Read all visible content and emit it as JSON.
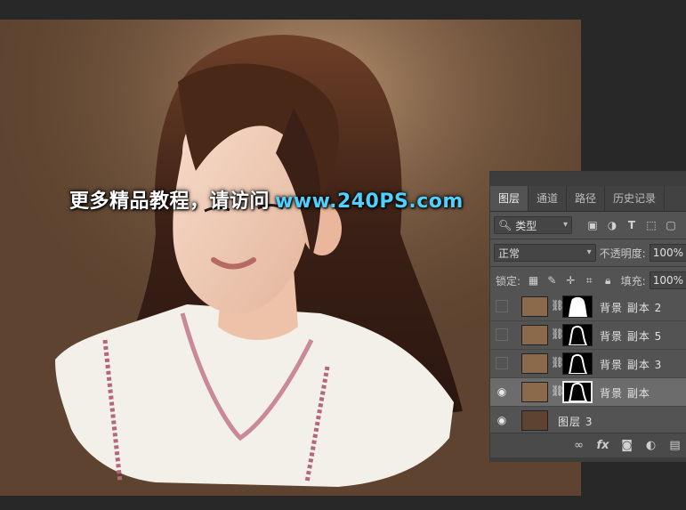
{
  "watermark": {
    "text": "更多精品教程，请访问",
    "url": "www.240PS.com"
  },
  "colors": {
    "canvas_bg": "#5e4430",
    "panel_bg": "#535353",
    "selected_layer": "#6c6c6c",
    "watermark_url": "#4fd0ff"
  },
  "panel": {
    "tabs": [
      {
        "label": "图层",
        "active": true
      },
      {
        "label": "通道",
        "active": false
      },
      {
        "label": "路径",
        "active": false
      },
      {
        "label": "历史记录",
        "active": false
      }
    ],
    "filter": {
      "label": "类型",
      "icon": "search-icon"
    },
    "filter_icons": [
      "image-icon",
      "adjustment-icon",
      "type-icon",
      "shape-icon",
      "smart-object-icon"
    ],
    "blend_mode": "正常",
    "opacity_label": "不透明度:",
    "opacity_value": "100%",
    "lock_label": "锁定:",
    "lock_icons": [
      "lock-transparent-icon",
      "lock-brush-icon",
      "lock-move-icon",
      "lock-artboard-icon",
      "lock-all-icon"
    ],
    "fill_label": "填充:",
    "fill_value": "100%",
    "layers": [
      {
        "name": "背景 副本 2",
        "visible": false,
        "selected": false
      },
      {
        "name": "背景 副本 5",
        "visible": false,
        "selected": false
      },
      {
        "name": "背景 副本 3",
        "visible": false,
        "selected": false
      },
      {
        "name": "背景 副本",
        "visible": true,
        "selected": true
      },
      {
        "name": "图层 3",
        "visible": true,
        "selected": false
      }
    ],
    "bottom_icons": [
      "link-layers-icon",
      "fx-icon",
      "add-mask-icon",
      "adjustment-layer-icon",
      "new-group-icon"
    ],
    "fx_label": "fx"
  }
}
